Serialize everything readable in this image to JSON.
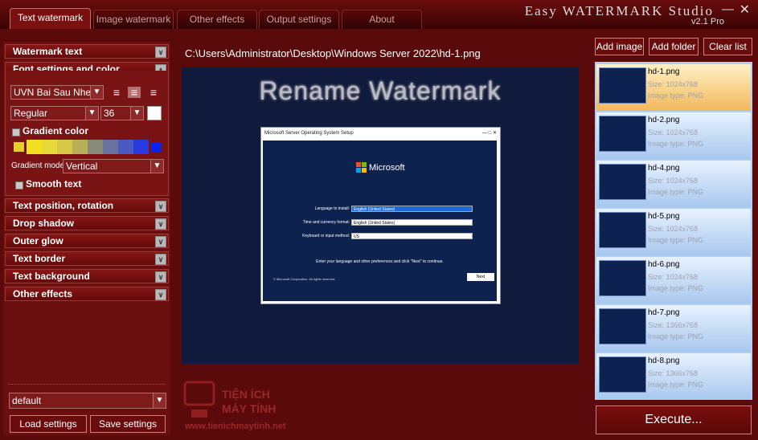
{
  "window": {
    "title": "Easy WATERMARK Studio",
    "version": "v2.1 Pro",
    "tabs": [
      "Text watermark",
      "Image watermark",
      "Other effects",
      "Output settings",
      "About"
    ],
    "active_tab": "Text watermark"
  },
  "left": {
    "sections": {
      "watermark_text": "Watermark text",
      "font_settings": "Font settings and color",
      "text_position": "Text position, rotation",
      "drop_shadow": "Drop shadow",
      "outer_glow": "Outer glow",
      "text_border": "Text border",
      "text_background": "Text background",
      "other_effects": "Other effects"
    },
    "font": {
      "family": "UVN Bai Sau Nhe",
      "style": "Regular",
      "size": "36",
      "color": "#ffffff",
      "alignment": "center"
    },
    "gradient": {
      "label": "Gradient color",
      "mode_label": "Gradient mode",
      "mode": "Vertical",
      "swatches": [
        "#e6cf2a",
        "#f0e020",
        "#e8d838",
        "#d8c848",
        "#b8b058",
        "#8a8a7a",
        "#6a72a0",
        "#4a5ac0",
        "#2a3ae0",
        "#1020ee"
      ]
    },
    "smooth_text": "Smooth text",
    "preset": "default",
    "load_settings": "Load settings",
    "save_settings": "Save settings"
  },
  "center": {
    "file_path": "C:\\Users\\Administrator\\Desktop\\Windows Server 2022\\hd-1.png",
    "watermark_text": "Rename Watermark",
    "dialog": {
      "title": "Microsoft Server Operating System Setup",
      "brand": "Microsoft",
      "language_label": "Language to install:",
      "language_value": "English (United States)",
      "time_label": "Time and currency format:",
      "time_value": "English (United States)",
      "keyboard_label": "Keyboard or input method:",
      "keyboard_value": "US",
      "hint": "Enter your language and other preferences and click \"Next\" to continue.",
      "copyright": "© Microsoft Corporation. All rights reserved.",
      "next": "Next"
    }
  },
  "right": {
    "add_image": "Add image",
    "add_folder": "Add folder",
    "clear_list": "Clear list",
    "files": [
      {
        "name": "hd-1.png",
        "size": "Size:  1024x768",
        "type": "Image type:  PNG",
        "selected": true
      },
      {
        "name": "hd-2.png",
        "size": "Size:  1024x768",
        "type": "Image type:  PNG",
        "selected": false
      },
      {
        "name": "hd-4.png",
        "size": "Size:  1024x768",
        "type": "Image type:  PNG",
        "selected": false
      },
      {
        "name": "hd-5.png",
        "size": "Size:  1024x768",
        "type": "Image type:  PNG",
        "selected": false
      },
      {
        "name": "hd-6.png",
        "size": "Size:  1024x768",
        "type": "Image type:  PNG",
        "selected": false
      },
      {
        "name": "hd-7.png",
        "size": "Size:  1366x768",
        "type": "Image type:  PNG",
        "selected": false
      },
      {
        "name": "hd-8.png",
        "size": "Size:  1366x768",
        "type": "Image type:  PNG",
        "selected": false
      }
    ],
    "execute": "Execute..."
  },
  "branding": {
    "logo_text_1": "TIỆN ÍCH",
    "logo_text_2": "MÁY TÍNH",
    "logo_url": "www.tienichmaytinh.net"
  }
}
